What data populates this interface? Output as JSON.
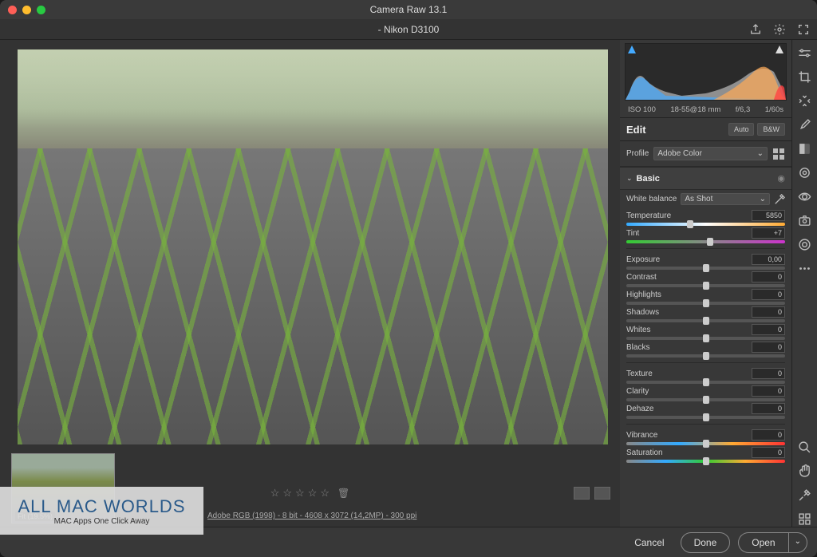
{
  "app": {
    "title": "Camera Raw 13.1"
  },
  "file": {
    "name": "-   Nikon D3100"
  },
  "exif": {
    "iso": "ISO 100",
    "lens": "18-55@18 mm",
    "aperture": "f/6,3",
    "shutter": "1/60s"
  },
  "edit": {
    "title": "Edit",
    "auto": "Auto",
    "bw": "B&W"
  },
  "profile": {
    "label": "Profile",
    "value": "Adobe Color"
  },
  "basic": {
    "title": "Basic",
    "wb_label": "White balance",
    "wb_value": "As Shot",
    "sliders": {
      "temperature": {
        "label": "Temperature",
        "value": "5850",
        "pos": 40
      },
      "tint": {
        "label": "Tint",
        "value": "+7",
        "pos": 53
      },
      "exposure": {
        "label": "Exposure",
        "value": "0,00",
        "pos": 50
      },
      "contrast": {
        "label": "Contrast",
        "value": "0",
        "pos": 50
      },
      "highlights": {
        "label": "Highlights",
        "value": "0",
        "pos": 50
      },
      "shadows": {
        "label": "Shadows",
        "value": "0",
        "pos": 50
      },
      "whites": {
        "label": "Whites",
        "value": "0",
        "pos": 50
      },
      "blacks": {
        "label": "Blacks",
        "value": "0",
        "pos": 50
      },
      "texture": {
        "label": "Texture",
        "value": "0",
        "pos": 50
      },
      "clarity": {
        "label": "Clarity",
        "value": "0",
        "pos": 50
      },
      "dehaze": {
        "label": "Dehaze",
        "value": "0",
        "pos": 50
      },
      "vibrance": {
        "label": "Vibrance",
        "value": "0",
        "pos": 50
      },
      "saturation": {
        "label": "Saturation",
        "value": "0",
        "pos": 50
      }
    }
  },
  "thumb": {
    "label": "Fit (19.5%)"
  },
  "info": "Adobe RGB (1998) - 8 bit - 4608 x 3072 (14,2MP) - 300 ppi",
  "footer": {
    "cancel": "Cancel",
    "done": "Done",
    "open": "Open"
  },
  "watermark": {
    "main": "ALL MAC WORLDS",
    "sub": "MAC Apps One Click Away"
  }
}
